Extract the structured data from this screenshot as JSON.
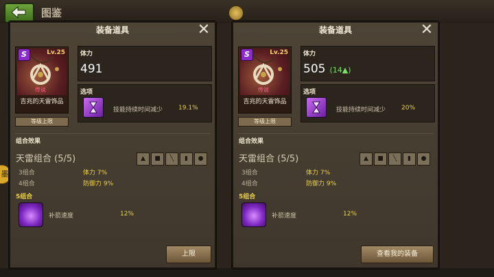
{
  "header": {
    "title": "图鉴"
  },
  "side_tag": "墨",
  "left_panel": {
    "title": "装备道具",
    "item": {
      "grade_badge": "S",
      "level": "Lv.25",
      "rarity": "传说",
      "name": "吉兆的天雷饰品",
      "level_cap_label": "等级上限"
    },
    "hp": {
      "label": "体力",
      "value": "491",
      "diff": ""
    },
    "option": {
      "label": "选项",
      "text": "技能持续时间减少",
      "value": "19.1%"
    },
    "set": {
      "section_label": "组合效果",
      "name": "天雷组合 (5/5)",
      "rows": [
        {
          "label": "3组合",
          "value": "体力 7%"
        },
        {
          "label": "4组合",
          "value": "防御力 9%"
        }
      ],
      "bonus5_label": "5组合",
      "bonus5_text": "补箭速度",
      "bonus5_value": "12%"
    },
    "action_label": "上限"
  },
  "right_panel": {
    "title": "装备道具",
    "item": {
      "grade_badge": "S",
      "level": "Lv.25",
      "rarity": "传说",
      "name": "吉兆的天雷饰品",
      "level_cap_label": "等级上限"
    },
    "hp": {
      "label": "体力",
      "value": "505",
      "diff": "(14▲)"
    },
    "option": {
      "label": "选项",
      "text": "技能持续时间减少",
      "value": "20%"
    },
    "set": {
      "section_label": "组合效果",
      "name": "天雷组合 (5/5)",
      "rows": [
        {
          "label": "3组合",
          "value": "体力 7%"
        },
        {
          "label": "4组合",
          "value": "防御力 9%"
        }
      ],
      "bonus5_label": "5组合",
      "bonus5_text": "补箭速度",
      "bonus5_value": "12%"
    },
    "action_label": "查看我的装备"
  },
  "slot_icons": [
    "helmet-icon",
    "armor-icon",
    "weapon-icon",
    "boots-icon",
    "accessory-icon"
  ],
  "colors": {
    "highlight_yellow": "#f0d24a",
    "increase_green": "#7ee06a",
    "rarity_pink": "#ff5d8a"
  }
}
